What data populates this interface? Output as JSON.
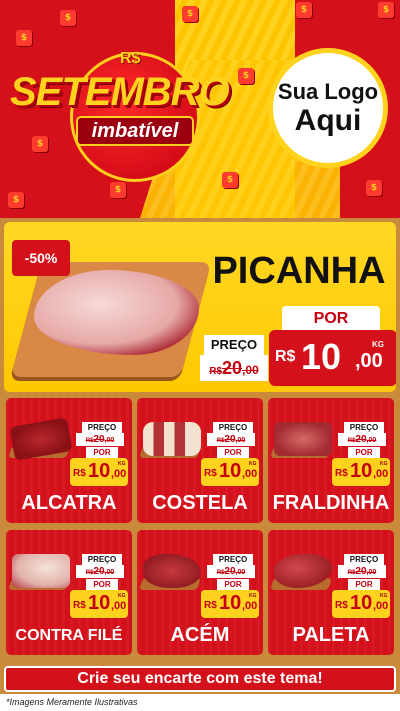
{
  "header": {
    "currency_symbol": "R$",
    "title": "SETEMBRO",
    "subtitle": "imbatível",
    "logo_line1": "Sua Logo",
    "logo_line2": "Aqui"
  },
  "hero": {
    "discount": "-50%",
    "product": "PICANHA",
    "old_label": "PREÇO",
    "old_currency": "R$",
    "old_value": "20",
    "old_cents": ",00",
    "new_label": "POR",
    "currency": "R$",
    "value": "10",
    "cents": ",00",
    "unit": "KG"
  },
  "products": [
    {
      "name": "ALCATRA",
      "old_label": "PREÇO",
      "old_currency": "R$",
      "old_value": "20",
      "old_cents": ",00",
      "new_label": "POR",
      "currency": "R$",
      "value": "10",
      "cents": ",00",
      "unit": "KG"
    },
    {
      "name": "COSTELA",
      "old_label": "PREÇO",
      "old_currency": "R$",
      "old_value": "20",
      "old_cents": ",00",
      "new_label": "POR",
      "currency": "R$",
      "value": "10",
      "cents": ",00",
      "unit": "KG"
    },
    {
      "name": "FRALDINHA",
      "old_label": "PREÇO",
      "old_currency": "R$",
      "old_value": "20",
      "old_cents": ",00",
      "new_label": "POR",
      "currency": "R$",
      "value": "10",
      "cents": ",00",
      "unit": "KG"
    },
    {
      "name": "CONTRA FILÉ",
      "old_label": "PREÇO",
      "old_currency": "R$",
      "old_value": "20",
      "old_cents": ",00",
      "new_label": "POR",
      "currency": "R$",
      "value": "10",
      "cents": ",00",
      "unit": "KG"
    },
    {
      "name": "ACÉM",
      "old_label": "PREÇO",
      "old_currency": "R$",
      "old_value": "20",
      "old_cents": ",00",
      "new_label": "POR",
      "currency": "R$",
      "value": "10",
      "cents": ",00",
      "unit": "KG"
    },
    {
      "name": "PALETA",
      "old_label": "PREÇO",
      "old_currency": "R$",
      "old_value": "20",
      "old_cents": ",00",
      "new_label": "POR",
      "currency": "R$",
      "value": "10",
      "cents": ",00",
      "unit": "KG"
    }
  ],
  "footer": {
    "cta": "Crie seu encarte com este tema!",
    "disclaimer": "*Imagens Meramente Ilustrativas"
  },
  "colors": {
    "primary_red": "#d4101a",
    "accent_yellow": "#ffd21e",
    "wood": "#c98a3c"
  }
}
